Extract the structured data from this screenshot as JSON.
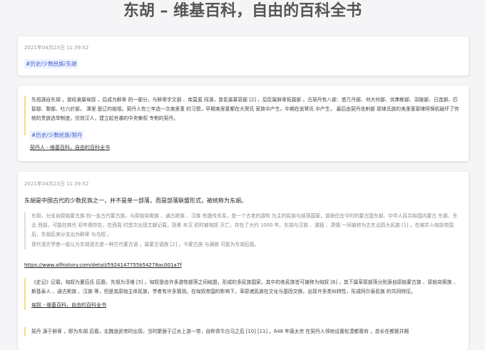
{
  "title": "东胡 – 维基百科，自由的百科全书",
  "card1": {
    "timestamp": "2021年04月23日 11:39:52",
    "tag": "#历史/少数民族/东胡"
  },
  "card2": {
    "quote": "先祖源自东胡 ，曾经隶属匈奴 ，后成为鲜卑 的一部分，与鲜卑宇文部 、库莫奚 同源，曾臣属慕容部 [2] ，后臣属鲜卑拓跋部 。古契丹有八部：悉万丹部、何大何部、伏弗郁部、羽陵部、日连部、匹絜部、黎部、吐六於部。 渾里 是辽的始祖。契丹人有三年选一次夷里堇 的习惯，早期夷里堇都在大贺氏 家族中产生，中期在遥辇氏 中产生， 最后由契丹迭剌部 耶律氏族的夷里堇耶律阿保机破坏了传统的贵族选举制度，仿效汉人，建立起世袭的中央集权 专制的契丹。",
    "tag": "#历史/少数民族/契丹",
    "source": "契丹人 - 维基百科，自由的百科全书"
  },
  "card3": {
    "timestamp": "2021年04月23日 11:39:52",
    "lead": "东胡是中国古代的少数民族之一，并不是单一部落，而是部落联盟形式，被统称为东胡。",
    "grey_quote_1": "东胡，分支自原始蒙古族 的一支古代蒙古族，与原始突厥族 、通古斯族 、汉族 有遗传关系，是一个古老的游牧 为主的民族与部落国家，曾居住在今时的蒙古国东部、中华人民共和国内蒙古 东部、东北 西部，可能在商代 初年便存在，在西周 时首次出现文献记载，到秦 末汉 初时被匈奴 灭亡，存在了大约 1000 年。东胡与汉族 、濊貊 、肃慎 一同被称为古东北四大民族 [1] 。在被并入匈奴帝国 后，东胡后来分支出为鲜卑 与乌桓 。",
    "grey_quote_2": "现代语言学者一般认为东胡语言是一种古代蒙古语 ，属蒙古语族 [2] 。今蒙古族 与满族 可能为东胡后裔。",
    "url": "https://www.allhistory.com/detail/5924147755b54278ac001a7f",
    "quote_2": "《史记》记载，匈奴为夏后氏 后裔，先祖为淳维 [5] 。匈奴是由许多游牧部落之间结盟，形成的多民族国家，其中的各民族皆可被称为匈奴 [6] ，其下属草原部落分别源自原始蒙古族 、原始突厥族 、斯基泰人 、通古斯族 、汉族 等，但是其原始主体民族，学者有许多猜测。在匈奴帝国的影响下，草原诸民族在文化与基因交换，出现许多类似特性，形成阿尔泰民族 的共同特征。",
    "source_2": "匈奴 - 维基百科，自由的百科全书",
    "quote_3": "契丹 源于鲜卑 ，即为东胡 后裔，北魏道武帝时出现，当时聚居于辽水上游一带，自称青牛白马之后 [10] [11] 。648 年唐太宗 在契丹人领地设置松漠都督府 ，酋长任都督并赐"
  }
}
